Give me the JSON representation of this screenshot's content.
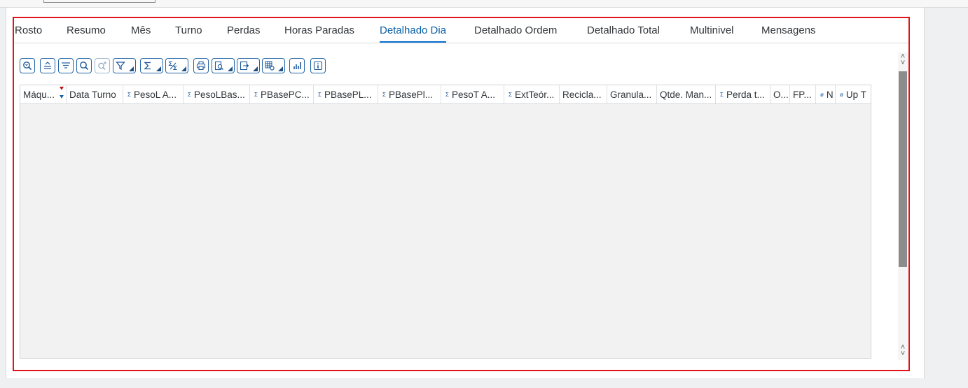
{
  "tabs": [
    {
      "label": "Rosto"
    },
    {
      "label": "Resumo"
    },
    {
      "label": "Mês"
    },
    {
      "label": "Turno"
    },
    {
      "label": "Perdas"
    },
    {
      "label": "Horas Paradas"
    },
    {
      "label": "Detalhado Dia",
      "active": true
    },
    {
      "label": "Detalhado Ordem"
    },
    {
      "label": "Detalhado Total"
    },
    {
      "label": "Multinivel"
    },
    {
      "label": "Mensagens"
    }
  ],
  "toolbar": {
    "buttons": [
      "zoom-details-icon",
      "sort-ascending-icon",
      "sort-descending-icon",
      "find-icon",
      "find-next-icon",
      "filter-icon",
      "total-icon",
      "subtotal-icon",
      "print-icon",
      "print-preview-icon",
      "export-icon",
      "layout-icon",
      "chart-icon",
      "info-icon"
    ]
  },
  "grid": {
    "columns": [
      {
        "label": "Máqu..."
      },
      {
        "label": "Data Turno"
      },
      {
        "label": "PesoL A..."
      },
      {
        "label": "PesoLBas..."
      },
      {
        "label": "PBasePC..."
      },
      {
        "label": "PBasePL..."
      },
      {
        "label": "PBasePl..."
      },
      {
        "label": "PesoT A..."
      },
      {
        "label": "ExtTeór..."
      },
      {
        "label": "Recicla..."
      },
      {
        "label": "Granula..."
      },
      {
        "label": "Qtde. Man..."
      },
      {
        "label": "Perda t..."
      },
      {
        "label": "O..."
      },
      {
        "label": "FP..."
      },
      {
        "label": "N"
      },
      {
        "label": "Up T"
      }
    ],
    "rows": []
  },
  "colors": {
    "frame_border": "#e0151b",
    "active_tab": "#0a5fa8",
    "icon_blue": "#1d5a9a"
  }
}
